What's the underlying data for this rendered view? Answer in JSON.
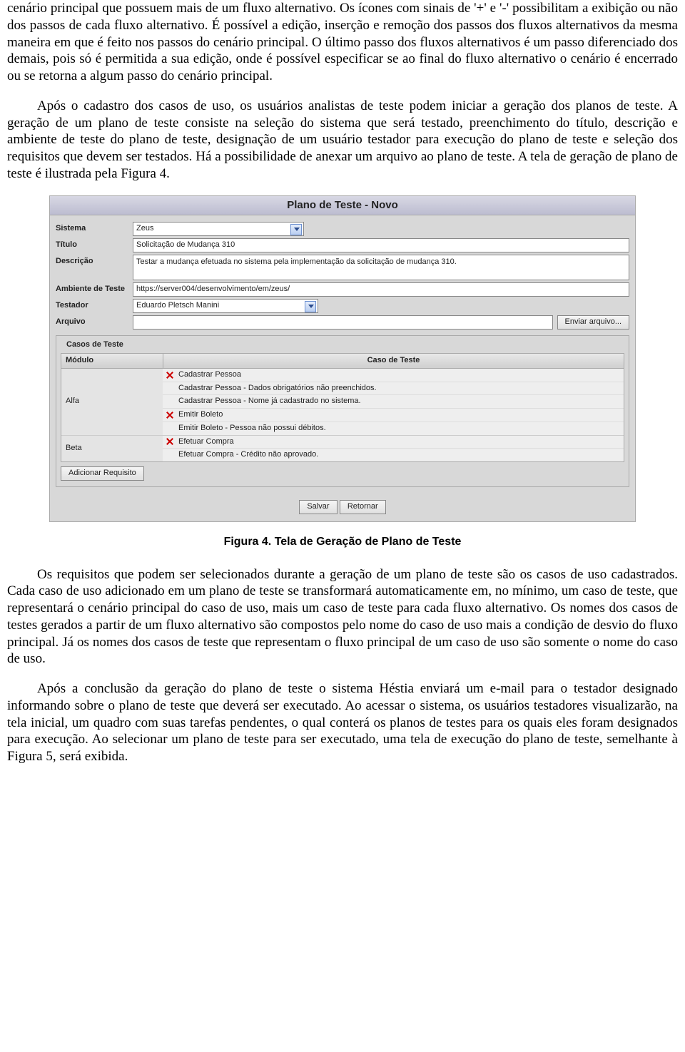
{
  "paragraphs": {
    "p1": "cenário principal que possuem mais de um fluxo alternativo. Os ícones com sinais de '+' e '-' possibilitam a exibição ou não dos passos de cada fluxo alternativo. É possível a edição, inserção e remoção dos passos dos fluxos alternativos da mesma maneira em que é feito nos passos do cenário principal. O último passo dos fluxos alternativos é um passo diferenciado dos demais, pois só é permitida a sua edição, onde é possível especificar se ao final do fluxo alternativo o cenário é encerrado ou se retorna a algum passo do cenário principal.",
    "p2": "Após o cadastro dos casos de uso, os usuários analistas de teste podem iniciar a geração dos planos de teste. A geração de um plano de teste consiste na seleção do sistema que será testado, preenchimento do título, descrição e ambiente de teste do plano de teste, designação de um usuário testador para execução do plano de teste e seleção dos requisitos que devem ser testados. Há a possibilidade de anexar um arquivo ao plano de teste. A tela de geração de plano de teste é ilustrada pela Figura 4.",
    "p3": "Os requisitos que podem ser selecionados durante a geração de um plano de teste são os casos de uso cadastrados. Cada caso de uso adicionado em um plano de teste se transformará automaticamente em, no mínimo, um caso de teste, que representará o cenário principal do caso de uso, mais um caso de teste para cada fluxo alternativo. Os nomes dos casos de testes gerados a partir de um fluxo alternativo são compostos pelo nome do caso de uso mais a condição de desvio do fluxo principal. Já os nomes dos casos de teste que representam o fluxo principal de um caso de uso são somente o nome do caso de uso.",
    "p4": "Após a conclusão da geração do plano de teste o sistema Héstia enviará um e-mail para o testador designado informando sobre o plano de teste que deverá ser executado. Ao acessar o sistema, os usuários testadores visualizarão, na tela inicial, um quadro com suas tarefas pendentes, o qual conterá os planos de testes para os quais eles foram designados para execução. Ao selecionar um plano de teste para ser executado, uma tela de execução do plano de teste, semelhante à Figura 5, será exibida."
  },
  "figure": {
    "title": "Plano de Teste - Novo",
    "labels": {
      "sistema": "Sistema",
      "titulo": "Título",
      "descricao": "Descrição",
      "ambiente": "Ambiente de Teste",
      "testador": "Testador",
      "arquivo": "Arquivo"
    },
    "values": {
      "sistema": "Zeus",
      "titulo": "Solicitação de Mudança 310",
      "descricao": "Testar a mudança efetuada no sistema pela implementação da solicitação de mudança 310.",
      "ambiente": "https://server004/desenvolvimento/em/zeus/",
      "testador": "Eduardo Pletsch Manini",
      "arquivo": ""
    },
    "buttons": {
      "enviar": "Enviar arquivo...",
      "adicionar": "Adicionar Requisito",
      "salvar": "Salvar",
      "retornar": "Retornar"
    },
    "table": {
      "legend": "Casos de Teste",
      "header_modulo": "Módulo",
      "header_caso": "Caso de Teste",
      "groups": [
        {
          "modulo": "Alfa",
          "rows": [
            {
              "remove": true,
              "text": "Cadastrar Pessoa"
            },
            {
              "remove": false,
              "text": "Cadastrar Pessoa - Dados obrigatórios não preenchidos."
            },
            {
              "remove": false,
              "text": "Cadastrar Pessoa - Nome já cadastrado no sistema."
            },
            {
              "remove": true,
              "text": "Emitir Boleto"
            },
            {
              "remove": false,
              "text": "Emitir Boleto - Pessoa não possui débitos."
            }
          ]
        },
        {
          "modulo": "Beta",
          "rows": [
            {
              "remove": true,
              "text": "Efetuar Compra"
            },
            {
              "remove": false,
              "text": "Efetuar Compra - Crédito não aprovado."
            }
          ]
        }
      ]
    },
    "caption": "Figura 4. Tela de Geração de Plano de Teste"
  }
}
